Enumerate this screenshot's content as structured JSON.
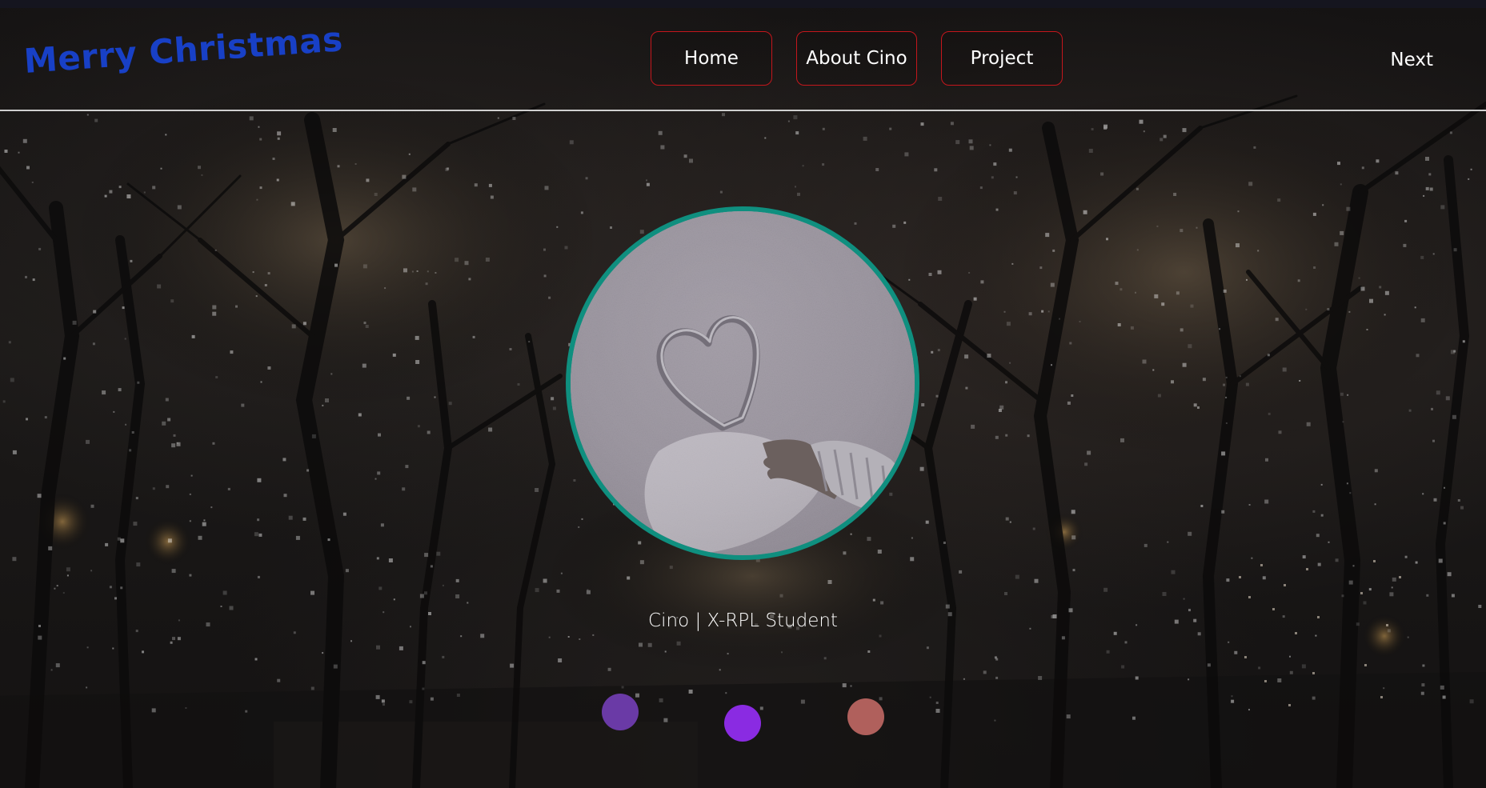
{
  "header": {
    "brand": "Merry Christmas",
    "nav": [
      {
        "label": "Home"
      },
      {
        "label": "About Cino"
      },
      {
        "label": "Project"
      }
    ],
    "next_label": "Next"
  },
  "profile": {
    "caption": "Cino | X-RPL Student"
  },
  "colors": {
    "brand": "#1840c6",
    "nav_border": "#c4161c",
    "ring": "#0f8f7f",
    "dot_1": "#6a3aa6",
    "dot_2": "#8a2be2",
    "dot_3": "#b0605c"
  }
}
